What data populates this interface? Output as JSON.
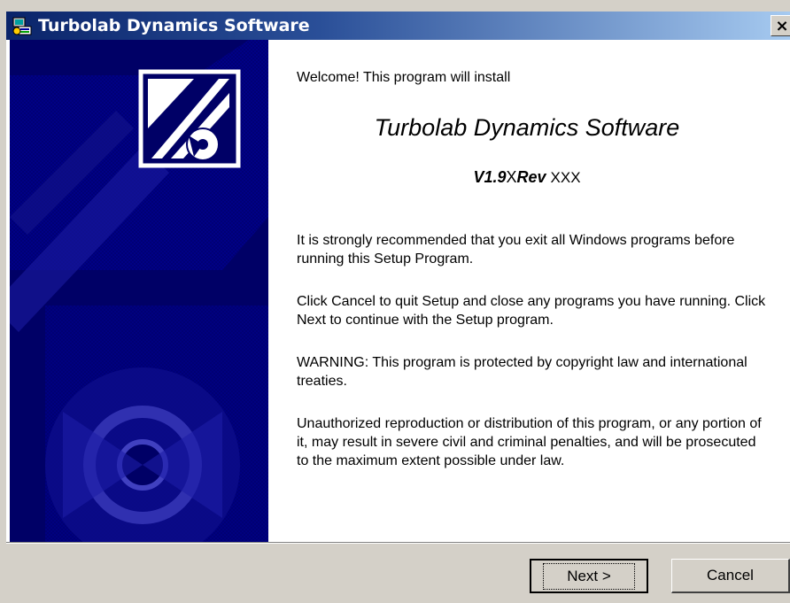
{
  "window": {
    "title": "Turbolab Dynamics Software",
    "close_label": "×"
  },
  "content": {
    "welcome": "Welcome!  This program will install",
    "product_name": "Turbolab Dynamics Software",
    "version_prefix": "V1.9",
    "version_x": "X",
    "version_rev": "Rev",
    "version_rev_value": "XXX",
    "paragraphs": [
      "It is strongly recommended that you exit all Windows programs before running this Setup Program.",
      "Click Cancel to quit Setup and close any programs you have running.  Click Next to continue with the Setup program.",
      "WARNING: This program is protected by copyright law and international treaties.",
      "Unauthorized reproduction or distribution of this program, or any portion of it, may result in severe civil and criminal penalties, and will be prosecuted to the maximum extent possible under law."
    ]
  },
  "buttons": {
    "next_label": "Next >",
    "cancel_label": "Cancel"
  },
  "colors": {
    "banner": "#000066",
    "titlebar_start": "#0a246a",
    "titlebar_end": "#a6caf0",
    "face": "#d4d0c8"
  },
  "icons": {
    "title": "installer-icon",
    "logo": "setup-logo-icon"
  }
}
